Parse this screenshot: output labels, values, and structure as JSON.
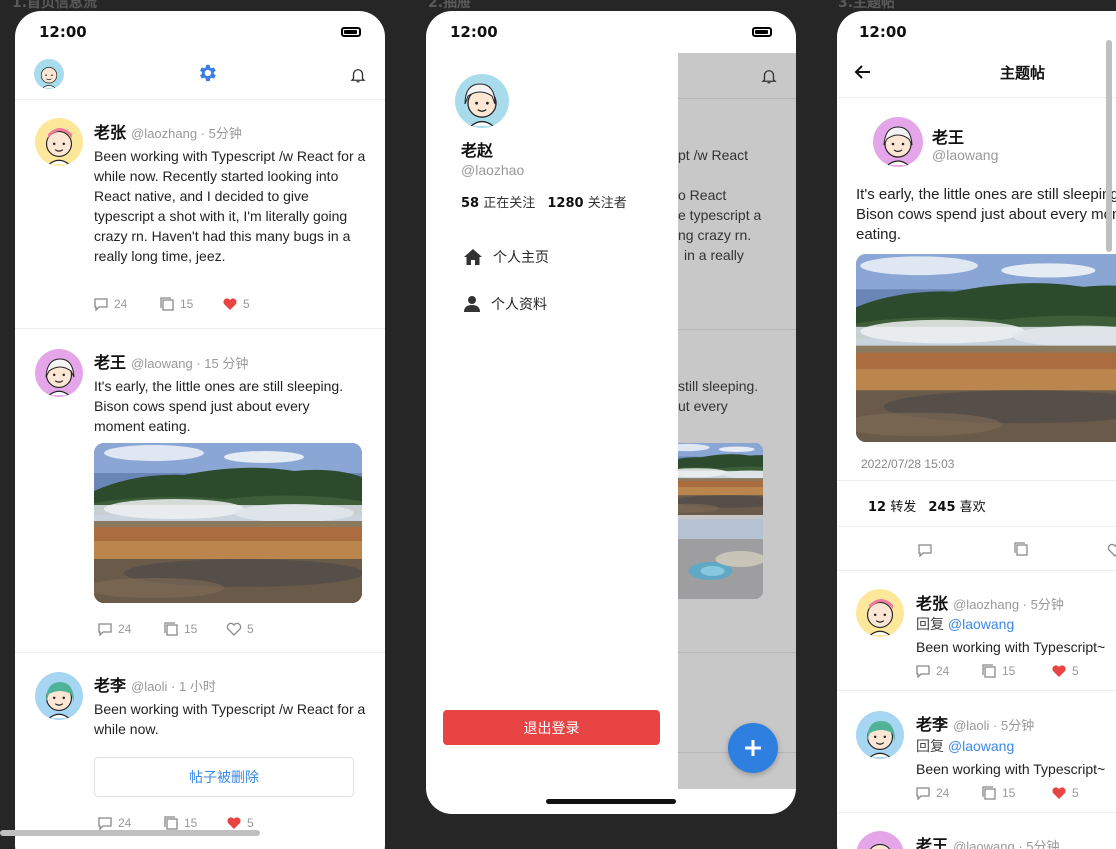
{
  "labels": {
    "screen1": "1.首页信息流",
    "screen2": "2.抽屉",
    "screen3": "3.主题帖"
  },
  "status_time": "12:00",
  "feed": {
    "posts": [
      {
        "name": "老张",
        "handle": "@laozhang · 5分钟",
        "text": "Been working with Typescript /w React for a while now. Recently started looking into React native, and I decided to give typescript a shot with it, I'm literally going crazy rn. Haven't had this many bugs in a really long time, jeez.",
        "comments": "24",
        "reposts": "15",
        "likes": "5",
        "liked": true
      },
      {
        "name": "老王",
        "handle": "@laowang · 15 分钟",
        "text": "It's early, the little ones are still sleeping. Bison cows spend just about every moment eating.",
        "comments": "24",
        "reposts": "15",
        "likes": "5",
        "liked": false
      },
      {
        "name": "老李",
        "handle": "@laoli · 1 小时",
        "text": "Been working with Typescript /w React for a while now.",
        "deleted_label": "帖子被删除",
        "comments": "24",
        "reposts": "15",
        "likes": "5",
        "liked": true
      }
    ]
  },
  "drawer": {
    "name": "老赵",
    "handle": "@laozhao",
    "following_count": "58",
    "following_label": "正在关注",
    "followers_count": "1280",
    "followers_label": "关注者",
    "menu": [
      {
        "label": "个人主页",
        "icon": "home-icon"
      },
      {
        "label": "个人资料",
        "icon": "user-icon"
      }
    ],
    "logout_label": "退出登录",
    "bg_fragments": [
      "pt /w React",
      "o React",
      "e typescript a",
      "ng crazy rn.",
      "in a really",
      "still sleeping.",
      "ut every"
    ]
  },
  "thread": {
    "title": "主题帖",
    "author_name": "老王",
    "author_handle": "@laowang",
    "text": "It's early, the little ones are still sleeping. Bison cows spend just about every moment eating.",
    "timestamp": "2022/07/28 15:03",
    "reposts_count": "12",
    "reposts_label": "转发",
    "likes_count": "245",
    "likes_label": "喜欢",
    "replies": [
      {
        "name": "老张",
        "handle": "@laozhang · 5分钟",
        "reply_prefix": "回复",
        "reply_to": "@laowang",
        "text": "Been working with Typescript~",
        "comments": "24",
        "reposts": "15",
        "likes": "5"
      },
      {
        "name": "老李",
        "handle": "@laoli · 5分钟",
        "reply_prefix": "回复",
        "reply_to": "@laowang",
        "text": "Been working with Typescript~",
        "comments": "24",
        "reposts": "15",
        "likes": "5"
      },
      {
        "name": "老王",
        "handle": "@laowang · 5分钟"
      }
    ]
  },
  "colors": {
    "accent": "#3a88e6",
    "like_red": "#e84444",
    "fab_blue": "#2f7fe0",
    "settings_blue": "#3a7ee6"
  }
}
